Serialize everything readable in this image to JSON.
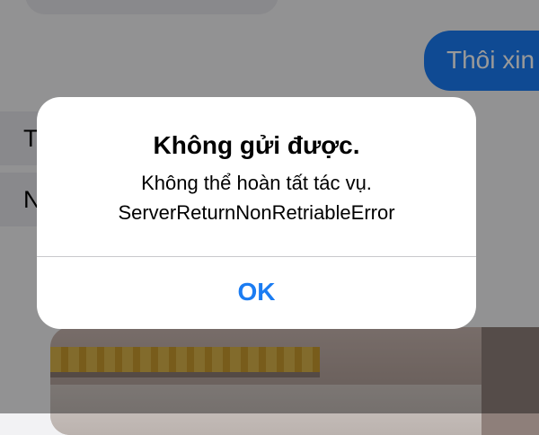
{
  "chat": {
    "outgoing_message": "Thôi xin",
    "incoming_messages": [
      "T",
      "N"
    ]
  },
  "alert": {
    "title": "Không gửi được.",
    "message_line1": "Không thể hoàn tất tác vụ.",
    "message_line2": "ServerReturnNonRetriableError",
    "ok_label": "OK"
  },
  "colors": {
    "accent": "#1b7cf2",
    "outgoing_bubble": "#1a7cf5",
    "incoming_bubble": "#e5e5ea",
    "dialog_background": "#ffffff"
  }
}
